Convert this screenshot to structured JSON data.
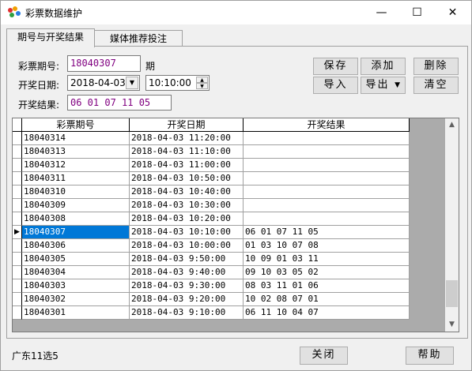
{
  "window": {
    "title": "彩票数据维护",
    "minimize_glyph": "—",
    "maximize_glyph": "☐",
    "close_glyph": "✕"
  },
  "tabs": [
    {
      "label": "期号与开奖结果",
      "active": true
    },
    {
      "label": "媒体推荐投注",
      "active": false
    }
  ],
  "form": {
    "period_label": "彩票期号:",
    "period_value": "18040307",
    "period_suffix": "期",
    "date_label": "开奖日期:",
    "date_value": "2018-04-03",
    "time_value": "10:10:00",
    "result_label": "开奖结果:",
    "result_value": "06 01 07 11 05"
  },
  "buttons": {
    "save": "保存",
    "add": "添加",
    "delete": "删除",
    "import": "导入",
    "export": "导出",
    "clear": "清空",
    "close": "关闭",
    "help": "帮助"
  },
  "table": {
    "columns": [
      "彩票期号",
      "开奖日期",
      "开奖结果"
    ],
    "selected_index": 7,
    "rows": [
      [
        "18040314",
        "2018-04-03 11:20:00",
        ""
      ],
      [
        "18040313",
        "2018-04-03 11:10:00",
        ""
      ],
      [
        "18040312",
        "2018-04-03 11:00:00",
        ""
      ],
      [
        "18040311",
        "2018-04-03 10:50:00",
        ""
      ],
      [
        "18040310",
        "2018-04-03 10:40:00",
        ""
      ],
      [
        "18040309",
        "2018-04-03 10:30:00",
        ""
      ],
      [
        "18040308",
        "2018-04-03 10:20:00",
        ""
      ],
      [
        "18040307",
        "2018-04-03 10:10:00",
        "06 01 07 11 05"
      ],
      [
        "18040306",
        "2018-04-03 10:00:00",
        "01 03 10 07 08"
      ],
      [
        "18040305",
        "2018-04-03 9:50:00",
        "10 09 01 03 11"
      ],
      [
        "18040304",
        "2018-04-03 9:40:00",
        "09 10 03 05 02"
      ],
      [
        "18040303",
        "2018-04-03 9:30:00",
        "08 03 11 01 06"
      ],
      [
        "18040302",
        "2018-04-03 9:20:00",
        "10 02 08 07 01"
      ],
      [
        "18040301",
        "2018-04-03 9:10:00",
        "06 11 10 04 07"
      ]
    ]
  },
  "status": {
    "lottery_name": "广东11选5"
  },
  "colors": {
    "selection": "#0078d7",
    "field_text": "#800080",
    "window_bg": "#f0f0f0"
  }
}
